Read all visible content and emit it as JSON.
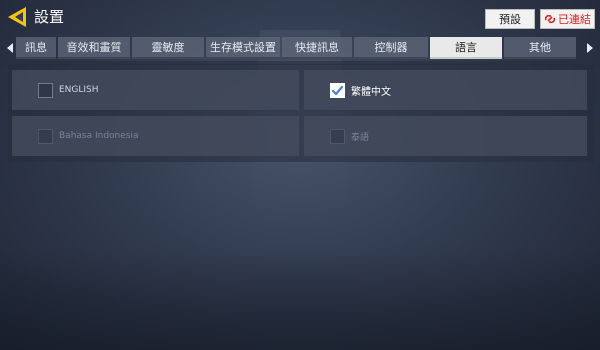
{
  "header": {
    "title": "設置",
    "preset_label": "預設",
    "connected_label": "已連結"
  },
  "tabs": [
    {
      "label": "訊息",
      "active": false
    },
    {
      "label": "音效和畫質",
      "active": false
    },
    {
      "label": "靈敏度",
      "active": false
    },
    {
      "label": "生存模式設置",
      "active": false
    },
    {
      "label": "快捷訊息",
      "active": false
    },
    {
      "label": "控制器",
      "active": false
    },
    {
      "label": "語言",
      "active": true
    },
    {
      "label": "其他",
      "active": false
    }
  ],
  "languages": [
    {
      "label": "ENGLISH",
      "checked": false
    },
    {
      "label": "繁體中文",
      "checked": true
    },
    {
      "label": "Bahasa Indonesia",
      "checked": false
    },
    {
      "label": "泰語",
      "checked": false
    }
  ],
  "colors": {
    "accent_yellow": "#f0c419",
    "connected_red": "#e02020",
    "active_tab_bg": "#e9e9ea"
  }
}
